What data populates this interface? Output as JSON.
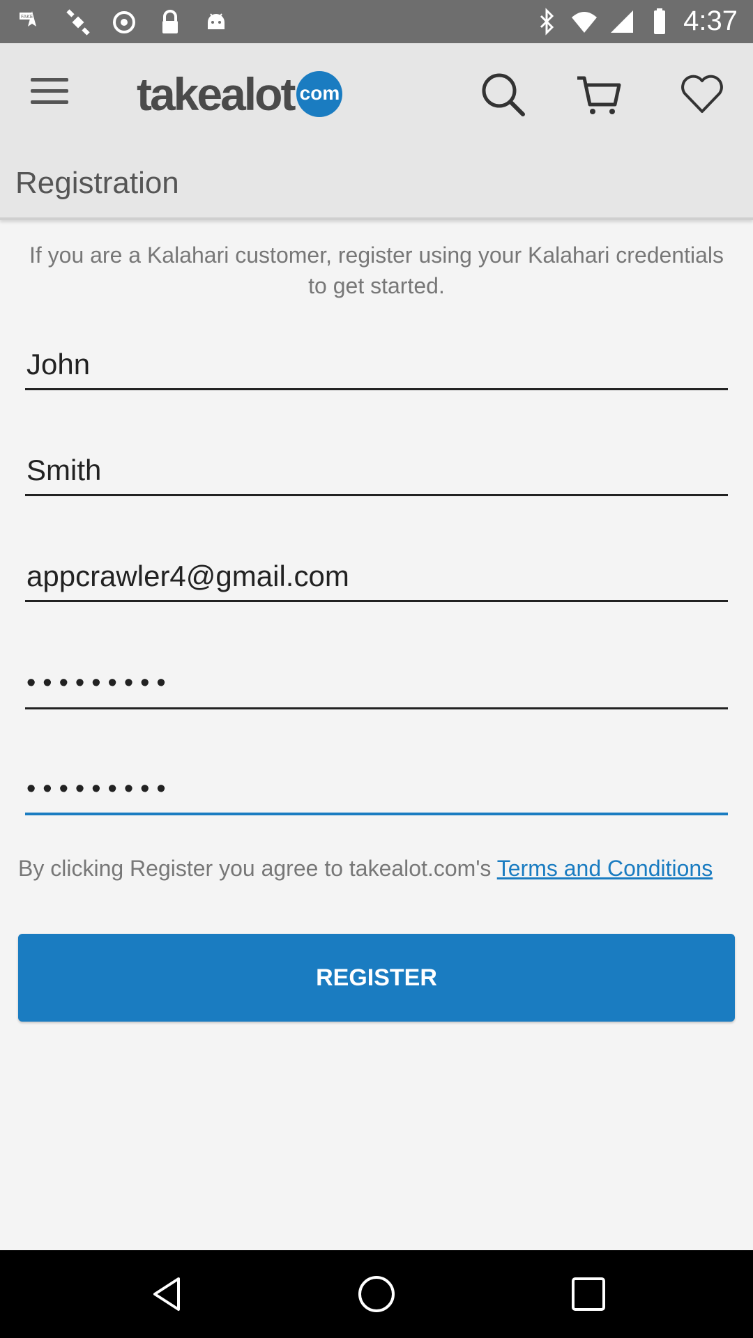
{
  "status_bar": {
    "time": "4:37",
    "icons": [
      "fake-gps-icon",
      "satellite-icon",
      "sync-icon",
      "lock-icon",
      "android-icon",
      "bluetooth-icon",
      "wifi-icon",
      "signal-icon",
      "battery-icon"
    ]
  },
  "app_bar": {
    "logo_text": "takealot",
    "logo_badge": "com",
    "icons": [
      "menu-icon",
      "search-icon",
      "cart-icon",
      "heart-icon"
    ]
  },
  "page": {
    "title": "Registration",
    "intro": "If you are a Kalahari customer, register using your Kalahari credentials to get started."
  },
  "form": {
    "first_name": "John",
    "last_name": "Smith",
    "email": "appcrawler4@gmail.com",
    "password": "•••••••••",
    "confirm_password": "•••••••••"
  },
  "terms": {
    "prefix": "By clicking Register you agree to takealot.com's ",
    "link": "Terms and Conditions"
  },
  "register_button": "REGISTER",
  "nav_bar": {
    "icons": [
      "back-icon",
      "home-icon",
      "recents-icon"
    ]
  },
  "colors": {
    "accent": "#1a7cc1",
    "app_bar": "#e6e6e6",
    "background": "#f4f4f4",
    "status_bar": "#6e6e6e"
  }
}
